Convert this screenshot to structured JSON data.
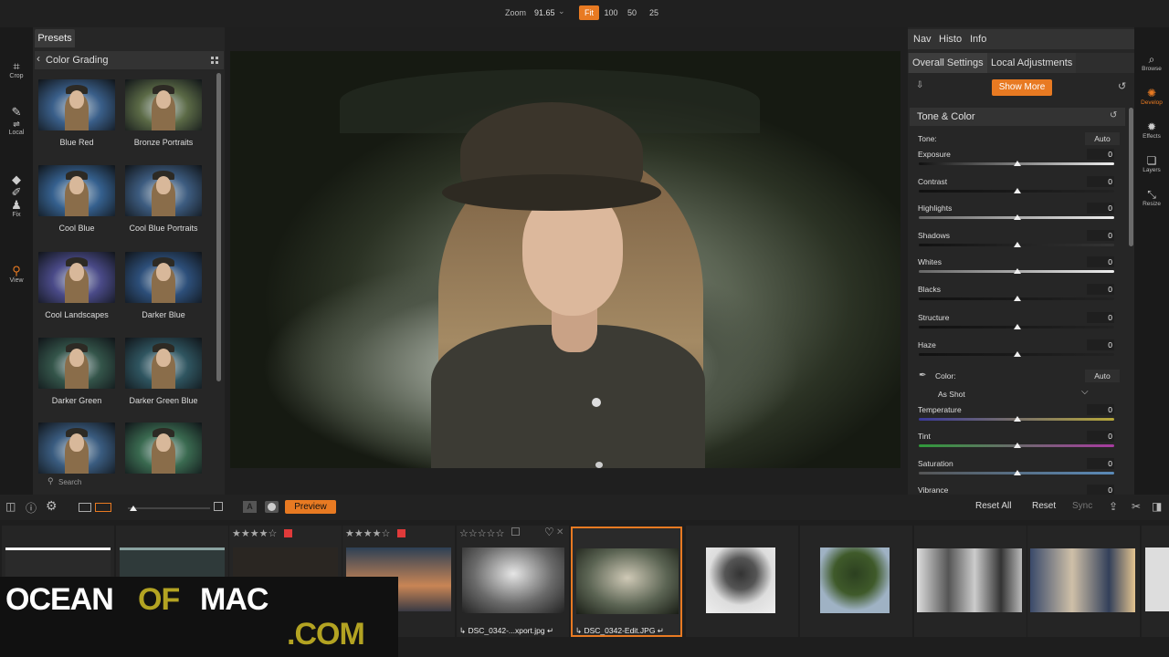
{
  "topbar": {
    "zoom_label": "Zoom",
    "zoom_value": "91.65",
    "zoom_options": [
      "Fit",
      "100",
      "50",
      "25"
    ]
  },
  "tools_left": [
    {
      "label": "Crop",
      "icon": "crop-icon"
    },
    {
      "label": "Local",
      "icon": "brush-icon"
    },
    {
      "label": "Fix",
      "icon": "stamp-icon"
    },
    {
      "label": "View",
      "icon": "magnifier-icon"
    }
  ],
  "presets": {
    "tab": "Presets",
    "category": "Color Grading",
    "search_placeholder": "Search",
    "items": [
      {
        "label": "Blue Red",
        "tone": "#3a5f8a"
      },
      {
        "label": "Bronze Portraits",
        "tone": "#5b6a46"
      },
      {
        "label": "Cool Blue",
        "tone": "#35608e"
      },
      {
        "label": "Cool Blue Portraits",
        "tone": "#3d5c80"
      },
      {
        "label": "Cool Landscapes",
        "tone": "#4a4a88"
      },
      {
        "label": "Darker Blue",
        "tone": "#2d4f7a"
      },
      {
        "label": "Darker Green",
        "tone": "#34554a"
      },
      {
        "label": "Darker Green Blue",
        "tone": "#2f5560"
      },
      {
        "label": "",
        "tone": "#3a5c80"
      },
      {
        "label": "",
        "tone": "#3a6a50"
      }
    ]
  },
  "right_panel": {
    "top_tabs": [
      "Nav",
      "Histo",
      "Info"
    ],
    "settings_tabs": [
      "Overall Settings",
      "Local Adjustments"
    ],
    "show_more": "Show More",
    "section_title": "Tone & Color",
    "tone_label": "Tone:",
    "auto_label": "Auto",
    "tone_sliders": [
      {
        "label": "Exposure",
        "value": "0"
      },
      {
        "label": "Contrast",
        "value": "0"
      },
      {
        "label": "Highlights",
        "value": "0"
      },
      {
        "label": "Shadows",
        "value": "0"
      },
      {
        "label": "Whites",
        "value": "0"
      },
      {
        "label": "Blacks",
        "value": "0"
      },
      {
        "label": "Structure",
        "value": "0"
      },
      {
        "label": "Haze",
        "value": "0"
      }
    ],
    "color_label": "Color:",
    "white_balance": "As Shot",
    "color_sliders": [
      {
        "label": "Temperature",
        "value": "0"
      },
      {
        "label": "Tint",
        "value": "0"
      },
      {
        "label": "Saturation",
        "value": "0"
      },
      {
        "label": "Vibrance",
        "value": "0"
      }
    ]
  },
  "tools_right": [
    {
      "label": "Browse",
      "icon": "browse-icon"
    },
    {
      "label": "Develop",
      "icon": "develop-icon",
      "active": true
    },
    {
      "label": "Effects",
      "icon": "effects-icon"
    },
    {
      "label": "Layers",
      "icon": "layers-icon"
    },
    {
      "label": "Resize",
      "icon": "resize-icon"
    }
  ],
  "bottom_bar": {
    "preview": "Preview",
    "reset_all": "Reset All",
    "reset": "Reset",
    "sync": "Sync",
    "a_label": "A"
  },
  "filmstrip": {
    "stars_a": "★★★★☆",
    "stars_b": "★★★★☆",
    "stars_c": "☆☆☆☆☆",
    "file_1": "DSC_0342-...xport.jpg",
    "file_2": "DSC_0342-Edit.JPG"
  },
  "watermark": {
    "ocean": "OCEAN",
    "of": "OF",
    "mac": "MAC",
    "com": ".COM"
  },
  "colors": {
    "accent": "#e87a22",
    "watermark_gold": "#b3a322"
  }
}
